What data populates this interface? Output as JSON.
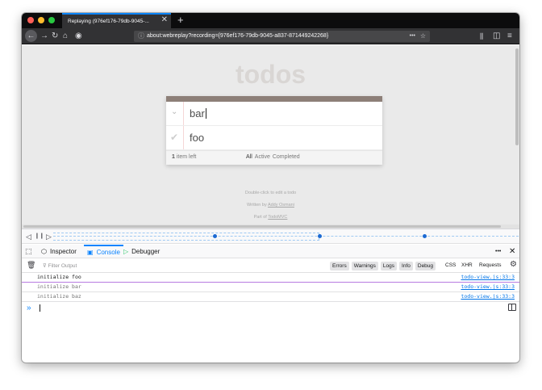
{
  "colors": {
    "close": "#ff5f57",
    "minimize": "#febc2e",
    "maximize": "#28c840",
    "accent": "#0a84ff",
    "todo_header": "#8d7f78"
  },
  "browser": {
    "tab_title": "Replaying (976ef176-79db-9045-...",
    "tab_close": "✕",
    "new_tab": "+",
    "url": "about:webreplay?recording={976ef176-79db-9045-a837-871449242268}",
    "url_more": "•••",
    "icons": [
      "back-icon",
      "forward-icon",
      "reload-icon",
      "home-icon",
      "record-icon",
      "info-icon",
      "bookmark-star-icon",
      "library-icon",
      "sidebar-icon",
      "menu-icon"
    ]
  },
  "app": {
    "title": "todos",
    "todos": [
      {
        "text": "bar",
        "editing": true
      },
      {
        "text": "foo",
        "completed": false
      }
    ],
    "count": "1",
    "count_label": "item left",
    "filters": [
      "All",
      "Active",
      "Completed"
    ],
    "info": {
      "hint": "Double-click to edit a todo",
      "written_by": "Written by",
      "author": "Addy Osmani",
      "part_of": "Part of",
      "project": "TodoMVC"
    }
  },
  "timeline": {
    "controls": [
      "◁",
      "❙❙",
      "▷"
    ],
    "progress": 0.572
  },
  "devtools": {
    "tabs": [
      {
        "label": "Inspector",
        "active": false
      },
      {
        "label": "Console",
        "active": true
      },
      {
        "label": "Debugger",
        "active": false
      }
    ],
    "more": "•••",
    "close": "✕",
    "filter_placeholder": "Filter Output",
    "level_buttons": [
      "Errors",
      "Warnings",
      "Logs",
      "Info",
      "Debug"
    ],
    "type_labels": [
      "CSS",
      "XHR",
      "Requests"
    ],
    "logs": [
      {
        "message": "initialize foo",
        "source": "todo-view.js:33:3",
        "dim": false
      },
      {
        "message": "initialize bar",
        "source": "todo-view.js:33:3",
        "dim": true
      },
      {
        "message": "initialize baz",
        "source": "todo-view.js:33:3",
        "dim": true
      }
    ],
    "prompt": "»"
  }
}
